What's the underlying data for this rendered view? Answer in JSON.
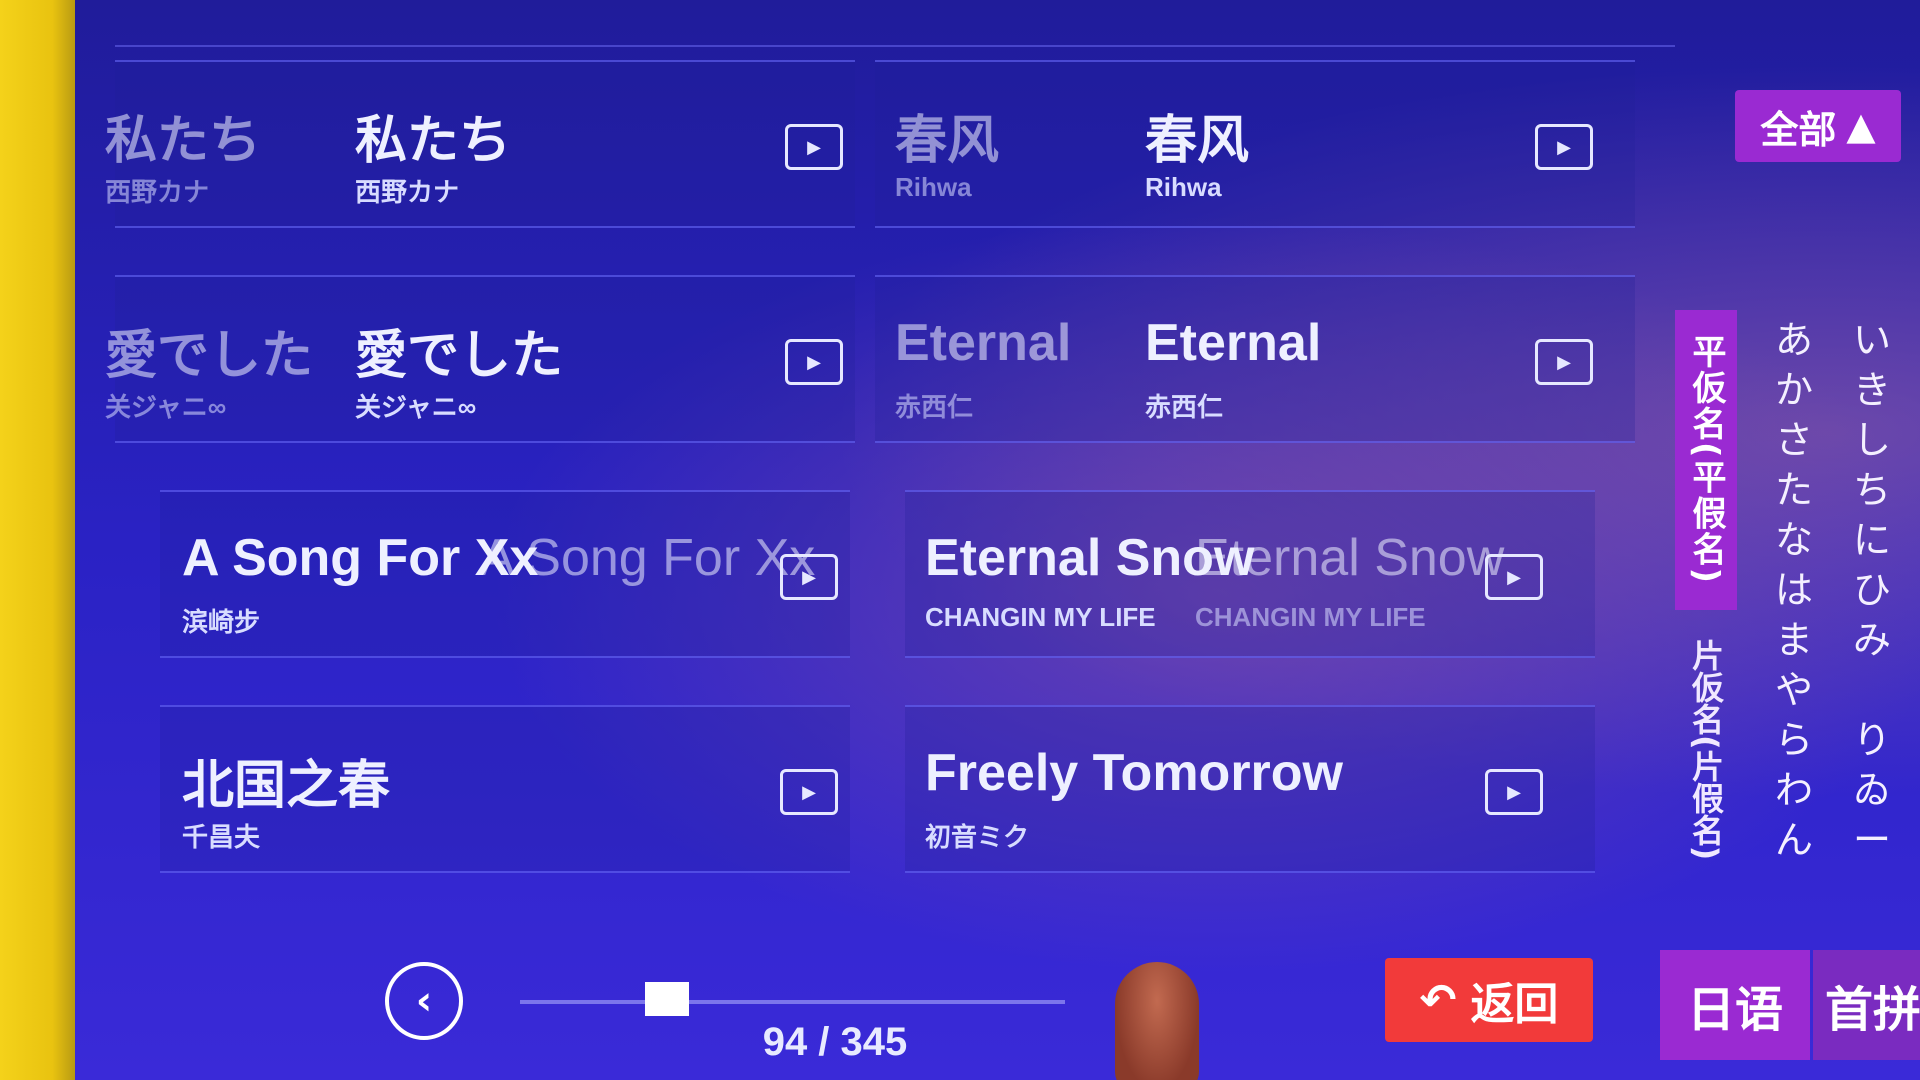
{
  "filter": {
    "label": "全部",
    "icon": "triangle-up-icon"
  },
  "songs": [
    {
      "title": "私たち",
      "artist": "西野カナ"
    },
    {
      "title": "春风",
      "artist": "Rihwa"
    },
    {
      "title": "愛でした",
      "artist": "关ジャニ∞"
    },
    {
      "title": "Eternal",
      "artist": "赤西仁"
    },
    {
      "title": "A Song For Xx",
      "artist": "滨崎步"
    },
    {
      "title": "Eternal Snow",
      "artist": "CHANGIN MY LIFE"
    },
    {
      "title": "北国之春",
      "artist": "千昌夫"
    },
    {
      "title": "Freely Tomorrow",
      "artist": "初音ミク"
    }
  ],
  "kana": {
    "hiragana_tab": "平仮名(平假名)",
    "katakana_tab": "片仮名(片假名)",
    "col1": [
      "あ",
      "か",
      "さ",
      "た",
      "な",
      "は",
      "ま",
      "や",
      "ら",
      "わ",
      "ん"
    ],
    "col2": [
      "い",
      "き",
      "し",
      "ち",
      "に",
      "ひ",
      "み",
      "",
      "り",
      "ゐ",
      "ー"
    ]
  },
  "pagination": {
    "current": 94,
    "total": 345,
    "text": "94 / 345"
  },
  "back": {
    "label": "返回"
  },
  "lang_tabs": {
    "active": "日语",
    "other": "首拼"
  }
}
